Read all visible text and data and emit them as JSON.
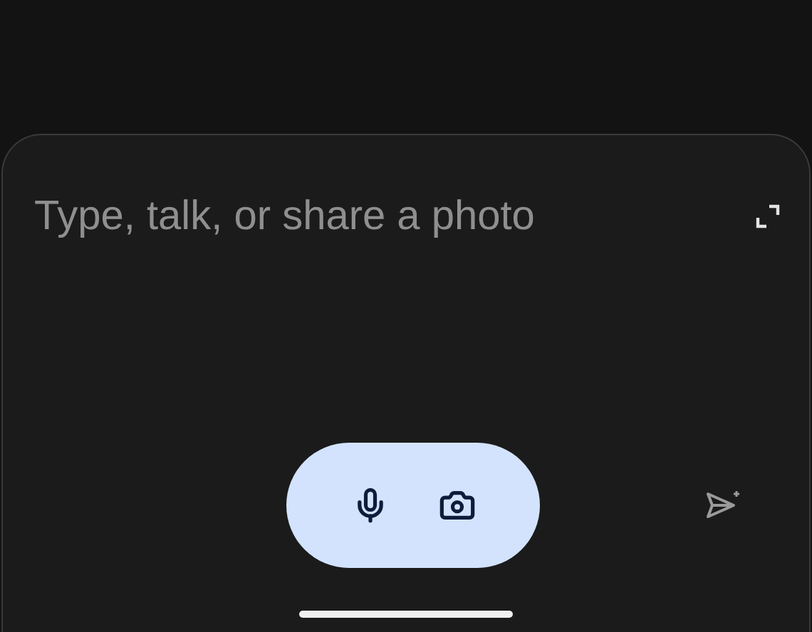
{
  "prompt": {
    "placeholder": "Type, talk, or share a photo"
  }
}
